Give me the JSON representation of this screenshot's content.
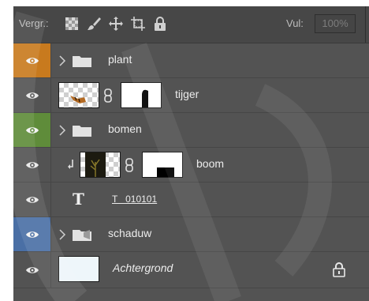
{
  "toolbar": {
    "lock_label": "Vergr.:",
    "lock_icons": [
      "lock-transparency-icon",
      "lock-paint-icon",
      "lock-position-icon",
      "lock-artboard-icon",
      "lock-all-icon"
    ],
    "fill_label": "Vul:",
    "fill_value": "100%"
  },
  "layers": [
    {
      "name": "plant",
      "type": "group",
      "eye_color": "#c87a1e"
    },
    {
      "name": "tijger",
      "type": "masked-layer",
      "eye_color": "#535353"
    },
    {
      "name": "bomen",
      "type": "group",
      "eye_color": "#5f8c3a"
    },
    {
      "name": "boom",
      "type": "clipped-masked-layer",
      "eye_color": "#535353"
    },
    {
      "name": "T   010101",
      "type": "text-layer",
      "eye_color": "#535353"
    },
    {
      "name": "schaduw",
      "type": "group",
      "eye_color": "#4a6fa5"
    },
    {
      "name": "Achtergrond",
      "type": "background",
      "eye_color": "#535353",
      "locked": true
    }
  ],
  "colors": {
    "panel_bg": "#535353",
    "toolbar_bg": "#474747",
    "text": "#ececec",
    "orange_label": "#c87a1e",
    "green_label": "#5f8c3a",
    "blue_label": "#4a6fa5"
  }
}
